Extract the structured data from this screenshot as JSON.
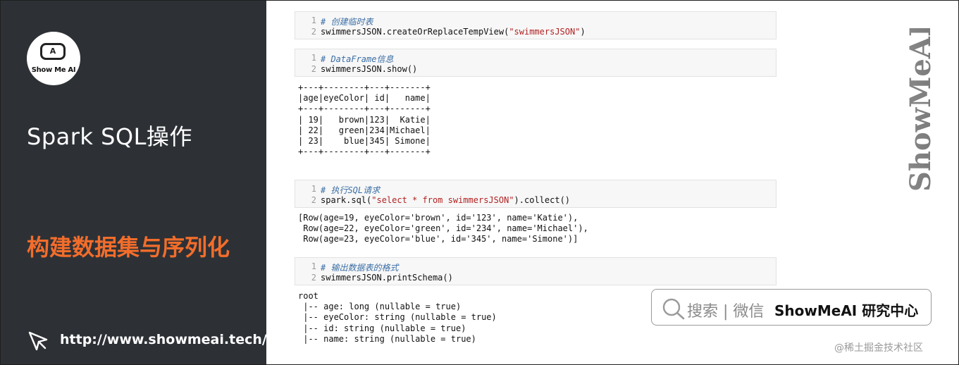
{
  "sidebar": {
    "logo_face": "A",
    "logo_text": "Show Me AI",
    "title": "Spark SQL操作",
    "subtitle": "构建数据集与序列化",
    "url": "http://www.showmeai.tech/"
  },
  "cells": [
    {
      "lines": [
        {
          "n": "1",
          "comment": "# 创建临时表"
        },
        {
          "n": "2",
          "code_pre": "swimmersJSON.createOrReplaceTempView(",
          "code_str": "\"swimmersJSON\"",
          "code_post": ")"
        }
      ]
    },
    {
      "lines": [
        {
          "n": "1",
          "comment": "# DataFrame信息"
        },
        {
          "n": "2",
          "code_pre": "swimmersJSON.show()",
          "code_str": "",
          "code_post": ""
        }
      ]
    },
    {
      "lines": [
        {
          "n": "1",
          "comment": "# 执行SQL请求"
        },
        {
          "n": "2",
          "code_pre": "spark.sql(",
          "code_str": "\"select * from swimmersJSON\"",
          "code_post": ").collect()"
        }
      ]
    },
    {
      "lines": [
        {
          "n": "1",
          "comment": "# 输出数据表的格式"
        },
        {
          "n": "2",
          "code_pre": "swimmersJSON.printSchema()",
          "code_str": "",
          "code_post": ""
        }
      ]
    }
  ],
  "outputs": {
    "show_table": [
      "+---+--------+---+-------+",
      "|age|eyeColor| id|   name|",
      "+---+--------+---+-------+",
      "| 19|   brown|123|  Katie|",
      "| 22|   green|234|Michael|",
      "| 23|    blue|345| Simone|",
      "+---+--------+---+-------+"
    ],
    "collect": [
      "[Row(age=19, eyeColor='brown', id='123', name='Katie'),",
      " Row(age=22, eyeColor='green', id='234', name='Michael'),",
      " Row(age=23, eyeColor='blue', id='345', name='Simone')]"
    ],
    "schema": [
      "root",
      " |-- age: long (nullable = true)",
      " |-- eyeColor: string (nullable = true)",
      " |-- id: string (nullable = true)",
      " |-- name: string (nullable = true)"
    ]
  },
  "brand_vertical": "ShowMeAI",
  "search_box": {
    "text": "搜索 | 微信",
    "brand": "ShowMeAI 研究中心"
  },
  "footer_credit": "@稀土掘金技术社区",
  "colors": {
    "sidebar_bg": "#2d3136",
    "accent_orange": "#f26d2b",
    "comment_blue": "#3a6ea5",
    "string_red": "#b22222"
  }
}
